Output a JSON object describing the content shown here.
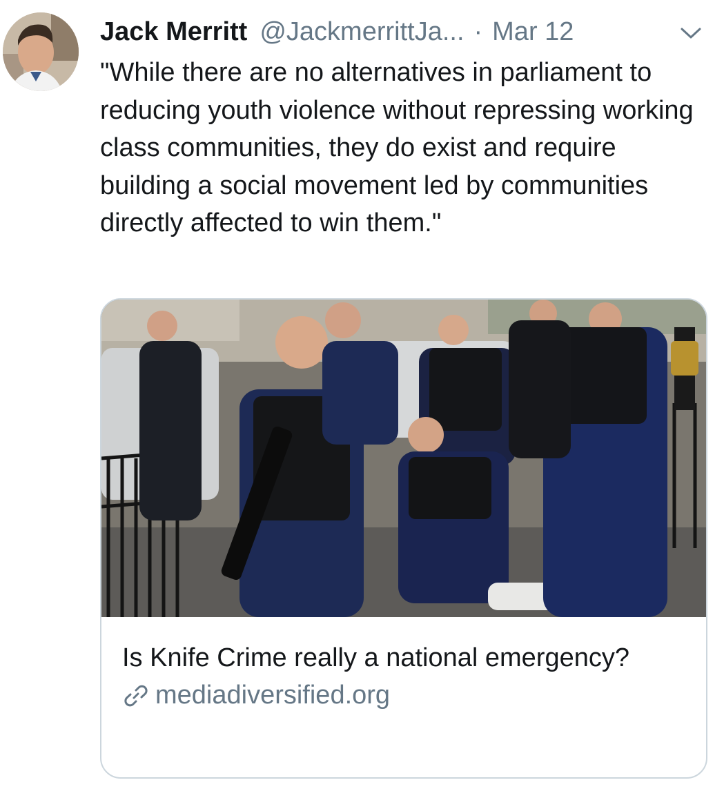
{
  "tweet": {
    "author_name": "Jack Merritt",
    "author_handle": "@JackmerrittJa...",
    "separator": "·",
    "date": "Mar 12",
    "body": "\"While there are no alternatives in parliament to reducing youth violence without repressing working class communities, they do exist and require building a social movement led by communities directly affected to win them.\""
  },
  "card": {
    "title": "Is Knife Crime really a national emergency?",
    "domain": "mediadiversified.org",
    "image_alt": "Armed police officers detaining a person on a London street"
  },
  "icons": {
    "menu": "chevron-down-icon",
    "link": "link-icon"
  },
  "colors": {
    "text": "#14171a",
    "secondary": "#657786",
    "card_border": "#ccd6dd"
  }
}
